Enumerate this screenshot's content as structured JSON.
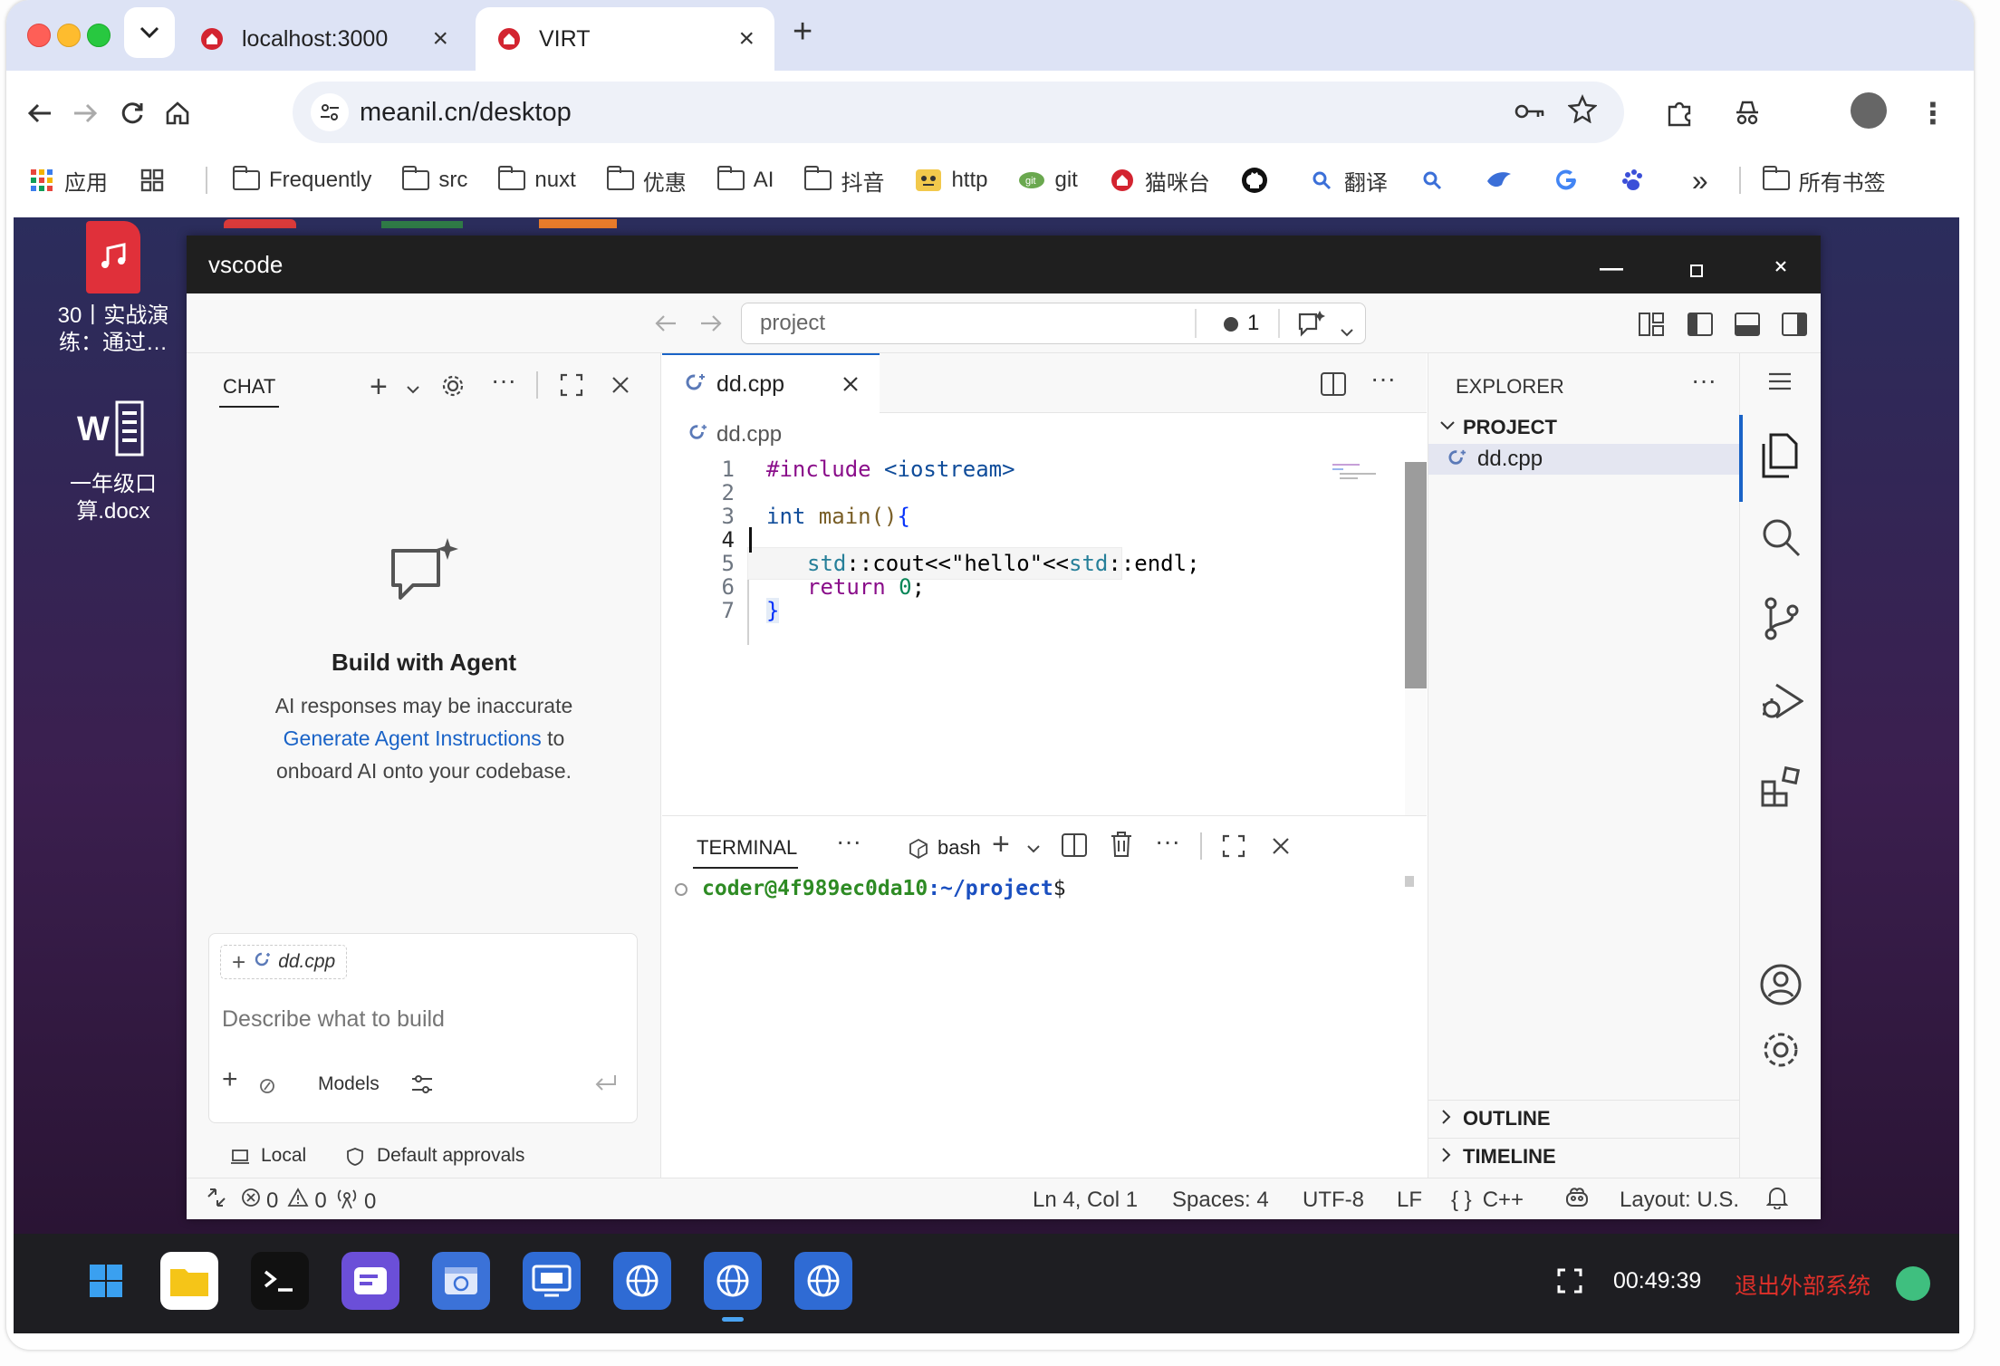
{
  "browser": {
    "tabs": [
      {
        "title": "localhost:3000"
      },
      {
        "title": "VIRT"
      }
    ],
    "new_tab_label": "+",
    "url": "meanil.cn/desktop",
    "bookmarks": [
      {
        "label": "应用",
        "icon": "apps-grid-icon"
      },
      {
        "label": "",
        "icon": "tab-groups-icon"
      },
      {
        "label": "Frequently",
        "icon": "folder-icon"
      },
      {
        "label": "src",
        "icon": "folder-icon"
      },
      {
        "label": "nuxt",
        "icon": "folder-icon"
      },
      {
        "label": "优惠",
        "icon": "folder-icon"
      },
      {
        "label": "AI",
        "icon": "folder-icon"
      },
      {
        "label": "抖音",
        "icon": "folder-icon"
      },
      {
        "label": "http",
        "icon": "emoji-icon"
      },
      {
        "label": "git",
        "icon": "git-icon"
      },
      {
        "label": "猫咪台",
        "icon": "house-icon"
      },
      {
        "label": "",
        "icon": "github-icon"
      },
      {
        "label": "翻译",
        "icon": "search-icon"
      }
    ],
    "more_bookmarks_label": "»",
    "all_bookmarks_label": "所有书签"
  },
  "desktop": {
    "icons": [
      {
        "label": "30丨实战演练：通过…",
        "icon": "music-file-icon"
      },
      {
        "label": "一年级口算.docx",
        "icon": "word-file-icon"
      }
    ],
    "clock": "00:49:39",
    "exit_label": "退出外部系统",
    "colors": {
      "exit": "#e0302a",
      "status_dot": "#3fbf7f"
    }
  },
  "vscode": {
    "window_title": "vscode",
    "command_center": {
      "text": "project",
      "problems_count": "1"
    },
    "chat": {
      "tab_label": "CHAT",
      "heading": "Build with Agent",
      "line1": "AI responses may be inaccurate",
      "link": "Generate Agent Instructions",
      "line2_suffix": " to",
      "line3": "onboard AI onto your codebase.",
      "context_file": "dd.cpp",
      "input_placeholder": "Describe what to build",
      "models_label": "Models",
      "local_label": "Local",
      "approvals_label": "Default approvals"
    },
    "editor": {
      "tab_label": "dd.cpp",
      "breadcrumb": "dd.cpp",
      "lines": [
        {
          "n": "1"
        },
        {
          "n": "2"
        },
        {
          "n": "3"
        },
        {
          "n": "4"
        },
        {
          "n": "5"
        },
        {
          "n": "6"
        },
        {
          "n": "7"
        }
      ],
      "tokens": {
        "include": "#include",
        "header": " <iostream>",
        "int_kw": "int",
        "main_sig": " main()",
        "open_brace": "{",
        "std1": "std",
        "cout": "::cout<<",
        "hello": "\"hello\"",
        "shl": "<<",
        "std2": "std",
        "endl": "::endl;",
        "return_kw": "return",
        "zero": " 0",
        "semi": ";",
        "close_brace": "}"
      }
    },
    "terminal": {
      "tab_label": "TERMINAL",
      "shell_label": "bash",
      "prompt_user": "coder@4f989ec0da10",
      "prompt_path": ":~/project",
      "prompt_end": "$"
    },
    "explorer": {
      "title": "EXPLORER",
      "project": "PROJECT",
      "file": "dd.cpp",
      "outline": "OUTLINE",
      "timeline": "TIMELINE"
    },
    "status": {
      "errors": "0",
      "warnings": "0",
      "ports": "0",
      "position": "Ln 4, Col 1",
      "spaces": "Spaces: 4",
      "encoding": "UTF-8",
      "eol": "LF",
      "language": "C++",
      "layout": "Layout: U.S."
    }
  }
}
